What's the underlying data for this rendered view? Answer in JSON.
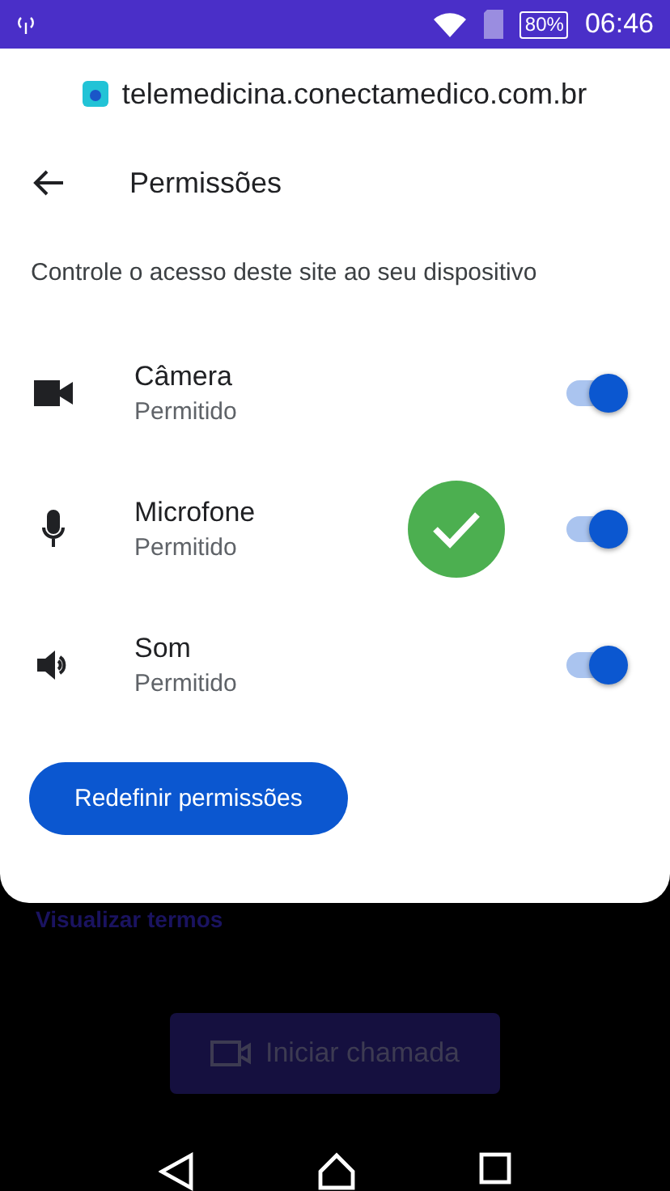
{
  "status_bar": {
    "battery": "80%",
    "time": "06:46"
  },
  "sheet": {
    "url": "telemedicina.conectamedico.com.br",
    "title": "Permissões",
    "description": "Controle o acesso deste site ao seu dispositivo",
    "permissions": [
      {
        "kind": "camera",
        "name": "Câmera",
        "status": "Permitido",
        "on": true,
        "confirmed": false
      },
      {
        "kind": "microphone",
        "name": "Microfone",
        "status": "Permitido",
        "on": true,
        "confirmed": true
      },
      {
        "kind": "sound",
        "name": "Som",
        "status": "Permitido",
        "on": true,
        "confirmed": false
      }
    ],
    "reset_button": "Redefinir permissões"
  },
  "background": {
    "link": "Visualizar termos",
    "call_button": "Iniciar chamada"
  }
}
